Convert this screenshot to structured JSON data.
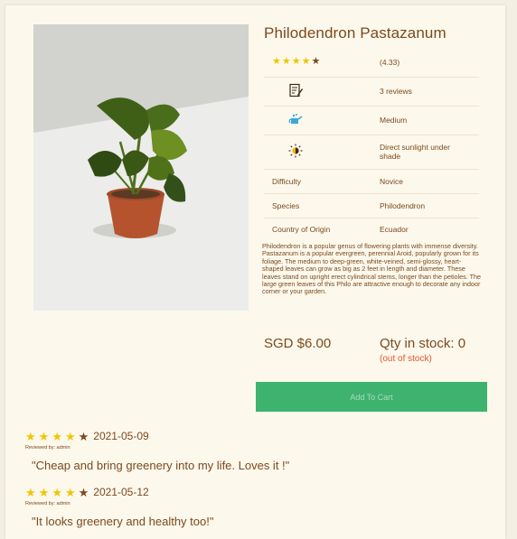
{
  "product": {
    "title": "Philodendron Pastazanum",
    "rating": "(4.33)",
    "rating_stars": 4.33,
    "reviews": "3 reviews",
    "water": "Medium",
    "light": "Direct sunlight under shade",
    "difficulty_label": "Difficulty",
    "difficulty": "Novice",
    "species_label": "Species",
    "species": "Philodendron",
    "origin_label": "Country of Origin",
    "origin": "Ecuador",
    "description": "Philodendron is a popular genus of flowering plants with immense diversity. Pastazanum is a popular evergreen, perennial Aroid, popularly grown for its foliage. The medium to deep-green, white-veined, semi-glossy, heart-shaped leaves can grow as big as 2 feet in length and diameter. These leaves stand on upright erect cylindrical stems, longer than the petioles. The large green leaves of this Philo are attractive enough to decorate any indoor corner or your garden.",
    "price": "SGD $6.00",
    "qty": "Qty in stock: 0",
    "stock_status": "(out of stock)",
    "cart_label": "Add To Cart"
  },
  "icons": {
    "reviews": "notepad-pen-icon",
    "water": "watering-can-icon",
    "light": "sun-icon"
  },
  "reviews": [
    {
      "rating": 4.5,
      "date": "2021-05-09",
      "by": "Reviewed by: admin",
      "text": "\"Cheap and bring greenery into my life. Loves it !\""
    },
    {
      "rating": 4.5,
      "date": "2021-05-12",
      "by": "Reviewed by: admin",
      "text": "\"It looks greenery and healthy too!\""
    }
  ],
  "colors": {
    "text": "#7a4a1e",
    "accent_button": "#3db36f",
    "out_of_stock": "#e2572b",
    "star": "#f2c500",
    "background": "#fdf8ec"
  }
}
